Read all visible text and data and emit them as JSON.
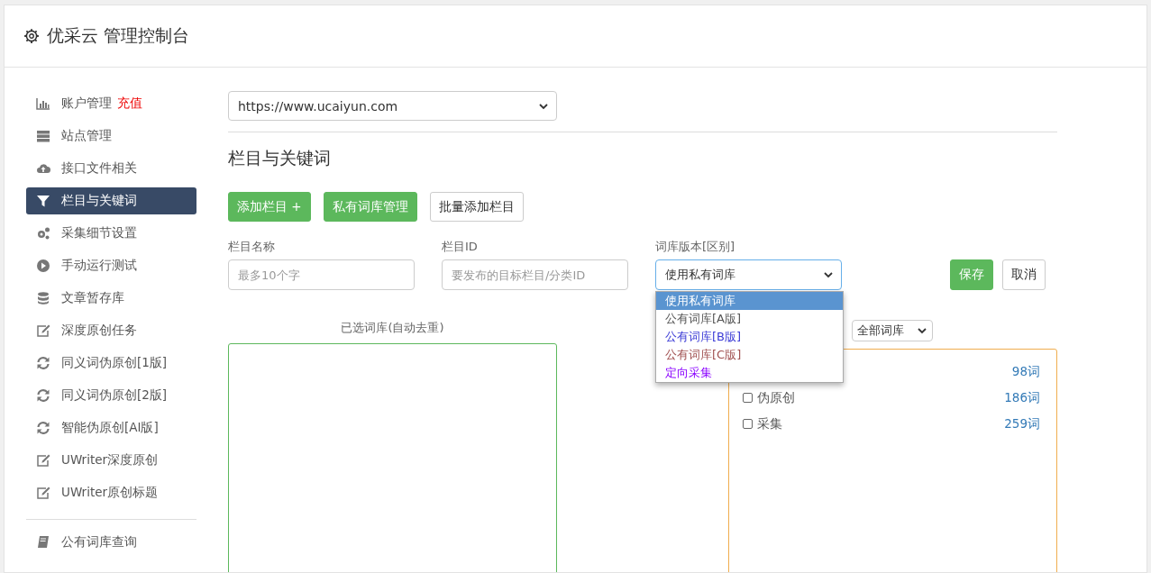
{
  "header": {
    "title": "优采云 管理控制台"
  },
  "sidebar": {
    "items": [
      {
        "label": "账户管理",
        "extra": "充值",
        "selected": false
      },
      {
        "label": "站点管理",
        "selected": false
      },
      {
        "label": "接口文件相关",
        "selected": false
      },
      {
        "label": "栏目与关键词",
        "selected": true
      },
      {
        "label": "采集细节设置",
        "selected": false
      },
      {
        "label": "手动运行测试",
        "selected": false
      },
      {
        "label": "文章暂存库",
        "selected": false
      },
      {
        "label": "深度原创任务",
        "selected": false
      },
      {
        "label": "同义词伪原创[1版]",
        "selected": false
      },
      {
        "label": "同义词伪原创[2版]",
        "selected": false
      },
      {
        "label": "智能伪原创[AI版]",
        "selected": false
      },
      {
        "label": "UWriter深度原创",
        "selected": false
      },
      {
        "label": "UWriter原创标题",
        "selected": false
      }
    ],
    "bottom_items": [
      {
        "label": "公有词库查询",
        "selected": false
      }
    ]
  },
  "site_select": {
    "value": "https://www.ucaiyun.com"
  },
  "section_title": "栏目与关键词",
  "actions": [
    {
      "label": "添加栏目 +",
      "kind": "primary"
    },
    {
      "label": "私有词库管理",
      "kind": "primary"
    },
    {
      "label": "批量添加栏目",
      "kind": "default"
    }
  ],
  "form": {
    "name_field": {
      "label": "栏目名称",
      "placeholder": "最多10个字"
    },
    "id_field": {
      "label": "栏目ID",
      "placeholder": "要发布的目标栏目/分类ID"
    },
    "library_field": {
      "label": "词库版本[区别]",
      "value": "使用私有词库",
      "expanded": true,
      "options": [
        {
          "label": "使用私有词库",
          "selected": true
        },
        {
          "label": "公有词库[A版]",
          "selected": false,
          "color": "#555555"
        },
        {
          "label": "公有词库[B版]",
          "selected": false,
          "color": "#3b3bd6"
        },
        {
          "label": "公有词库[C版]",
          "selected": false,
          "color": "#a05050"
        },
        {
          "label": "定向采集",
          "selected": false,
          "color": "#8a00ff"
        }
      ]
    },
    "save": "保存",
    "cancel": "取消"
  },
  "selected_libraries": {
    "label": "已选词库(自动去重)"
  },
  "library_list": {
    "filter": "全部词库",
    "rows": [
      {
        "count": "98词"
      },
      {
        "name": "伪原创",
        "count": "186词",
        "checked": false
      },
      {
        "name": "采集",
        "count": "259词",
        "checked": false
      }
    ]
  }
}
